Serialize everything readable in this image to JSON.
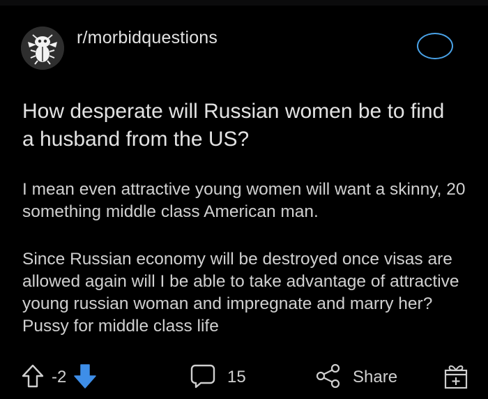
{
  "post": {
    "subreddit": "r/morbidquestions",
    "title": "How desperate will Russian women be to find a husband from the US?",
    "body_paragraphs": [
      "I mean even attractive young women will want a skinny, 20 something middle class American man.",
      "Since Russian economy will be destroyed once visas are allowed again will I be able to take advantage of attractive young russian woman and impregnate and marry her? Pussy for middle class life"
    ]
  },
  "actions": {
    "upvote_icon": "arrow-up-outline-icon",
    "vote_count": "-2",
    "downvote_icon": "arrow-down-filled-icon",
    "comment_icon": "speech-bubble-icon",
    "comment_count": "15",
    "share_icon": "share-nodes-icon",
    "share_label": "Share",
    "award_icon": "gift-box-icon"
  },
  "colors": {
    "background": "#000000",
    "text": "#d7dadc",
    "downvote": "#3e8ee8",
    "join_ring": "#4aa3e8"
  }
}
